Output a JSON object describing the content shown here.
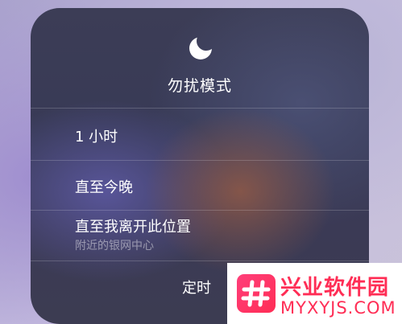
{
  "dnd_menu": {
    "title": "勿扰模式",
    "options": [
      {
        "label": "1 小时"
      },
      {
        "label": "直至今晚"
      },
      {
        "label": "直至我离开此位置",
        "subtitle": "附近的银网中心"
      }
    ],
    "footer_button": "定时",
    "icon": "moon-icon"
  },
  "watermark": {
    "title": "兴业软件园",
    "domain": "MYXYJS.COM",
    "logo_icon": "hash-icon",
    "color": "#ff2d55"
  }
}
